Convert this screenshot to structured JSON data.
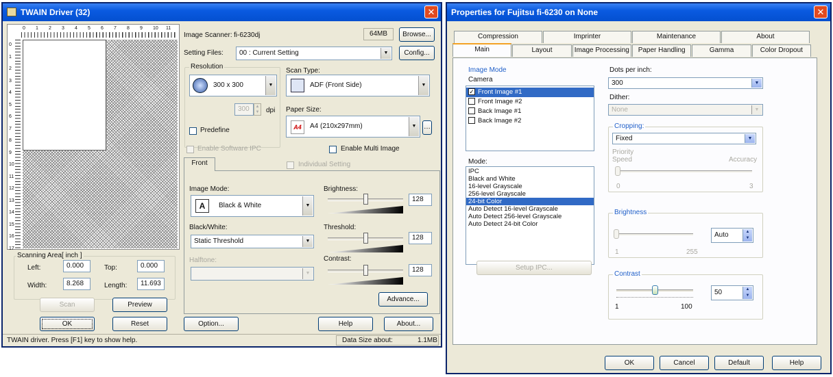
{
  "twain": {
    "title": "TWAIN Driver (32)",
    "ruler_numbers": [
      "0",
      "1",
      "2",
      "3",
      "4",
      "5",
      "6",
      "7",
      "8",
      "9",
      "10",
      "11"
    ],
    "vruler_numbers": [
      "0",
      "1",
      "2",
      "3",
      "4",
      "5",
      "6",
      "7",
      "8",
      "9",
      "10",
      "11",
      "12",
      "13",
      "14",
      "15",
      "16",
      "17"
    ],
    "scanning_area_label": "Scanning Area[ inch ]",
    "left_label": "Left:",
    "left_value": "0.000",
    "top_label": "Top:",
    "top_value": "0.000",
    "width_label": "Width:",
    "width_value": "8.268",
    "length_label": "Length:",
    "length_value": "11.693",
    "scan_button": "Scan",
    "preview_button": "Preview",
    "ok_button": "OK",
    "reset_button": "Reset",
    "image_scanner_label": "Image Scanner:",
    "image_scanner_value": "fi-6230dj",
    "memory": "64MB",
    "browse_button": "Browse...",
    "setting_files_label": "Setting Files:",
    "setting_files_value": "00 : Current Setting",
    "config_button": "Config...",
    "resolution_label": "Resolution",
    "resolution_value": "300 x 300",
    "dpi_value": "300",
    "dpi_label": "dpi",
    "predefine_label": "Predefine",
    "scan_type_label": "Scan Type:",
    "scan_type_value": "ADF (Front Side)",
    "paper_size_label": "Paper Size:",
    "paper_size_value": "A4 (210x297mm)",
    "paper_icon_text": "A4",
    "enable_software_ipc": "Enable Software IPC",
    "enable_multi_image": "Enable Multi Image",
    "front_tab": "Front",
    "individual_setting": "Individual Setting",
    "image_mode_label": "Image Mode:",
    "image_mode_value": "Black & White",
    "brightness_label": "Brightness:",
    "brightness_value": "128",
    "bw_label": "Black/White:",
    "bw_value": "Static Threshold",
    "threshold_label": "Threshold:",
    "threshold_value": "128",
    "halftone_label": "Halftone:",
    "contrast_label": "Contrast:",
    "contrast_value": "128",
    "advance_button": "Advance...",
    "option_button": "Option...",
    "help_button": "Help",
    "about_button": "About...",
    "status_text": "TWAIN driver. Press [F1] key to show help.",
    "data_size_label": "Data Size about:",
    "data_size_value": "1.1MB",
    "levels": {
      "brightness": 0.5,
      "threshold": 0.5,
      "contrast": 0.5
    }
  },
  "props": {
    "title": "Properties for Fujitsu fi-6230 on None",
    "tabs_top": [
      "Compression",
      "Imprinter",
      "Maintenance",
      "About"
    ],
    "tabs_bottom": [
      "Main",
      "Layout",
      "Image Processing",
      "Paper Handling",
      "Gamma",
      "Color Dropout"
    ],
    "image_mode_group": "Image Mode",
    "camera_label": "Camera",
    "camera_items": [
      {
        "label": "Front Image #1",
        "checked": true,
        "selected": true
      },
      {
        "label": "Front Image #2",
        "checked": false,
        "selected": false
      },
      {
        "label": "Back Image #1",
        "checked": false,
        "selected": false
      },
      {
        "label": "Back Image #2",
        "checked": false,
        "selected": false
      }
    ],
    "mode_label": "Mode:",
    "mode_items": [
      "IPC",
      "Black and White",
      "16-level Grayscale",
      "256-level Grayscale",
      "24-bit Color",
      "Auto Detect 16-level Grayscale",
      "Auto Detect 256-level Grayscale",
      "Auto Detect 24-bit Color"
    ],
    "mode_selected": "24-bit Color",
    "setup_ipc_button": "Setup IPC...",
    "dots_per_inch_label": "Dots per inch:",
    "dpi_value": "300",
    "dither_label": "Dither:",
    "dither_value": "None",
    "cropping_label": "Cropping:",
    "cropping_value": "Fixed",
    "priority_label": "Priority",
    "speed_label": "Speed",
    "accuracy_label": "Accuracy",
    "priority_min": "0",
    "priority_max": "3",
    "brightness_label": "Brightness",
    "brightness_value": "Auto",
    "brightness_min": "1",
    "brightness_max": "255",
    "contrast_label": "Contrast",
    "contrast_value": "50",
    "contrast_min": "1",
    "contrast_max": "100",
    "contrast_level": 0.5,
    "ok_button": "OK",
    "cancel_button": "Cancel",
    "default_button": "Default",
    "help_button": "Help"
  }
}
